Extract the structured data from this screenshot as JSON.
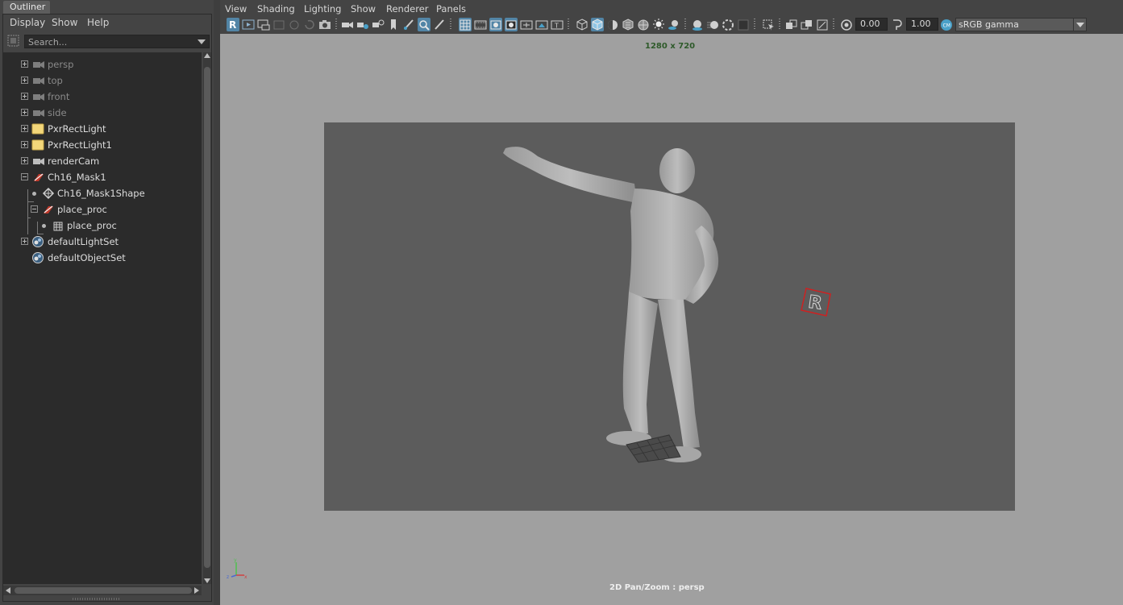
{
  "outliner": {
    "tab_title": "Outliner",
    "menu": [
      "Display",
      "Show",
      "Help"
    ],
    "search_placeholder": "Search...",
    "items": [
      {
        "label": "persp",
        "icon": "camera-icon",
        "dim": true
      },
      {
        "label": "top",
        "icon": "camera-icon",
        "dim": true
      },
      {
        "label": "front",
        "icon": "camera-icon",
        "dim": true
      },
      {
        "label": "side",
        "icon": "camera-icon",
        "dim": true
      },
      {
        "label": "PxrRectLight",
        "icon": "rect-light-icon",
        "dim": false
      },
      {
        "label": "PxrRectLight1",
        "icon": "rect-light-icon",
        "dim": false
      },
      {
        "label": "renderCam",
        "icon": "camera-icon",
        "dim": false
      },
      {
        "label": "Ch16_Mask1",
        "icon": "transform-icon",
        "dim": false
      },
      {
        "label": "Ch16_Mask1Shape",
        "icon": "mesh-shape-icon",
        "dim": false
      },
      {
        "label": "place_proc",
        "icon": "transform-icon",
        "dim": false
      },
      {
        "label": "place_proc",
        "icon": "procedural-icon",
        "dim": false
      },
      {
        "label": "defaultLightSet",
        "icon": "set-icon",
        "dim": false
      },
      {
        "label": "defaultObjectSet",
        "icon": "set-icon",
        "dim": false
      }
    ]
  },
  "viewport": {
    "menu": [
      "View",
      "Shading",
      "Lighting",
      "Show",
      "Renderer",
      "Panels"
    ],
    "exposure_value": "0.00",
    "gamma_value": "1.00",
    "color_space": "sRGB gamma",
    "resolution_label": "1280 x 720",
    "camera_label": "2D Pan/Zoom : persp",
    "colors": {
      "canvas_bg": "#a0a0a0",
      "gate_bg": "#5c5c5c",
      "toolbar_active": "#5285a6",
      "light_locator": "#cc2222"
    }
  }
}
